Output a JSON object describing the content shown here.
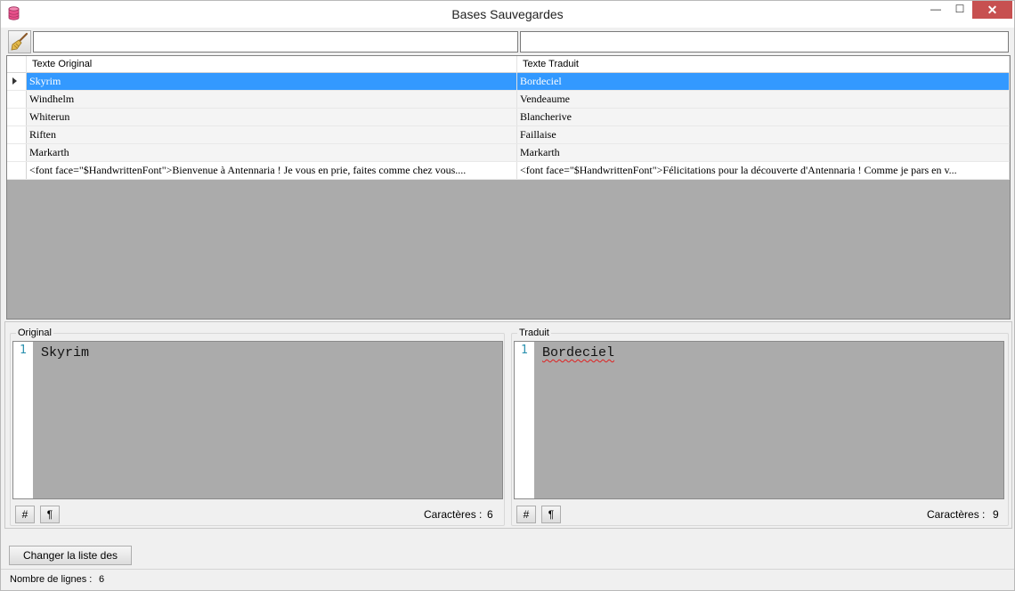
{
  "window": {
    "title": "Bases Sauvegardes",
    "minimize_glyph": "—",
    "maximize_glyph": "☐",
    "close_glyph": "✕"
  },
  "filter": {
    "original_value": "",
    "translated_value": "",
    "clear_icon": "broom-icon"
  },
  "grid": {
    "columns": [
      "Texte Original",
      "Texte Traduit"
    ],
    "selected_index": 0,
    "rows": [
      {
        "original": "Skyrim",
        "translated": "Bordeciel"
      },
      {
        "original": "Windhelm",
        "translated": "Vendeaume"
      },
      {
        "original": "Whiterun",
        "translated": "Blancherive"
      },
      {
        "original": "Riften",
        "translated": "Faillaise"
      },
      {
        "original": "Markarth",
        "translated": "Markarth"
      },
      {
        "original": "<font face=\"$HandwrittenFont\">Bienvenue à Antennaria ! Je vous en prie, faites comme chez vous....",
        "translated": "<font face=\"$HandwrittenFont\">Félicitations pour la découverte d'Antennaria ! Comme je pars en v..."
      }
    ]
  },
  "editor_original": {
    "legend": "Original",
    "line_number": "1",
    "text": "Skyrim",
    "hash_label": "#",
    "pilcrow_label": "¶",
    "char_label": "Caractères :",
    "char_count": "6"
  },
  "editor_translated": {
    "legend": "Traduit",
    "line_number": "1",
    "text": "Bordeciel",
    "hash_label": "#",
    "pilcrow_label": "¶",
    "char_label": "Caractères :",
    "char_count": "9"
  },
  "bottom": {
    "change_button": "Changer la liste des bases",
    "status_label": "Nombre de lignes :",
    "status_value": "6"
  },
  "colors": {
    "selection": "#3399ff",
    "editor_bg": "#ababab",
    "close_button": "#c75050",
    "line_number": "#2b91af"
  }
}
